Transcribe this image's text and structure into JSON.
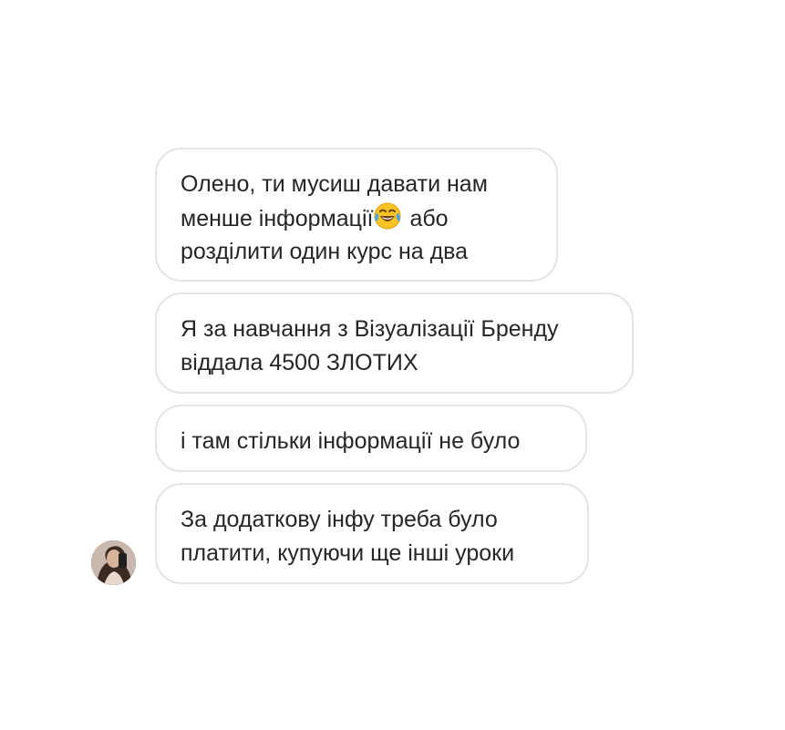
{
  "conversation": {
    "messages": [
      {
        "lines": [
          "Олено, ти мусиш давати нам",
          "менше інформації",
          "або",
          "розділити один курс на два"
        ],
        "emoji": "😂",
        "emoji_icon": "face-with-tears-of-joy-icon"
      },
      {
        "lines": [
          "Я за навчання з Візуалізації Бренду",
          "віддала 4500 ЗЛОТИХ"
        ]
      },
      {
        "lines": [
          "і там стільки інформації не було"
        ]
      },
      {
        "lines": [
          "За додаткову інфу треба було",
          "платити, купуючи ще інші уроки"
        ]
      }
    ],
    "sender_avatar_icon": "user-avatar-icon"
  },
  "colors": {
    "bubble_border": "#e4e4e4",
    "text": "#262626",
    "background": "#ffffff"
  }
}
